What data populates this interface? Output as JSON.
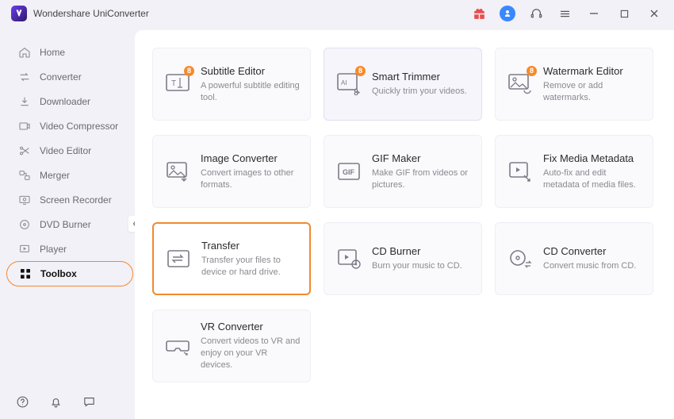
{
  "app_title": "Wondershare UniConverter",
  "sidebar": {
    "items": [
      {
        "label": "Home"
      },
      {
        "label": "Converter"
      },
      {
        "label": "Downloader"
      },
      {
        "label": "Video Compressor"
      },
      {
        "label": "Video Editor"
      },
      {
        "label": "Merger"
      },
      {
        "label": "Screen Recorder"
      },
      {
        "label": "DVD Burner"
      },
      {
        "label": "Player"
      },
      {
        "label": "Toolbox"
      }
    ],
    "active_index": 9
  },
  "cards": [
    {
      "title": "Subtitle Editor",
      "desc": "A powerful subtitle editing tool.",
      "badge": "8"
    },
    {
      "title": "Smart Trimmer",
      "desc": "Quickly trim your videos.",
      "badge": "8"
    },
    {
      "title": "Watermark Editor",
      "desc": "Remove or add watermarks.",
      "badge": "8"
    },
    {
      "title": "Image Converter",
      "desc": "Convert images to other formats."
    },
    {
      "title": "GIF Maker",
      "desc": "Make GIF from videos or pictures."
    },
    {
      "title": "Fix Media Metadata",
      "desc": "Auto-fix and edit metadata of media files."
    },
    {
      "title": "Transfer",
      "desc": "Transfer your files to device or hard drive."
    },
    {
      "title": "CD Burner",
      "desc": "Burn your music to CD."
    },
    {
      "title": "CD Converter",
      "desc": "Convert music from CD."
    },
    {
      "title": "VR Converter",
      "desc": "Convert videos to VR and enjoy on your VR devices."
    }
  ]
}
